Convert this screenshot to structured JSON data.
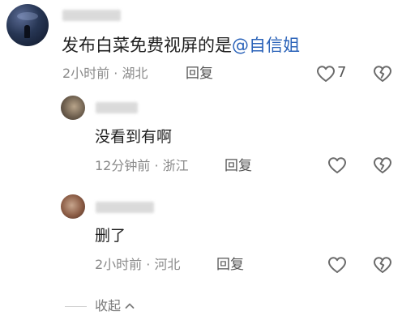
{
  "main_comment": {
    "text": "发布白菜免费视屏的是",
    "mention": "@自信姐",
    "meta": "2小时前 · 湖北",
    "reply_label": "回复",
    "like_count": "7"
  },
  "replies": [
    {
      "text": "没看到有啊",
      "meta": "12分钟前 · 浙江",
      "reply_label": "回复"
    },
    {
      "text": "删了",
      "meta": "2小时前 · 河北",
      "reply_label": "回复"
    }
  ],
  "collapse_label": "收起",
  "icons": {
    "like": "heart-outline-icon",
    "dislike": "broken-heart-outline-icon",
    "collapse": "chevron-up-icon"
  },
  "colors": {
    "mention": "#2b63b9",
    "meta": "#8a8a8a"
  }
}
